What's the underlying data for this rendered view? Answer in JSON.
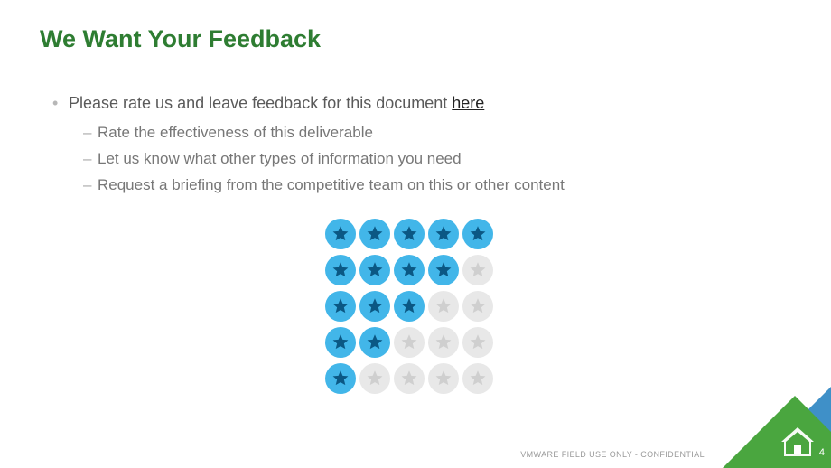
{
  "title": "We Want Your Feedback",
  "bullet": {
    "text_prefix": "Please rate us and leave feedback for this document ",
    "link_text": "here"
  },
  "sub_items": [
    "Rate the effectiveness of this deliverable",
    "Let us know what other types of information you need",
    "Request a briefing from the competitive team on this or other content"
  ],
  "ratings": [
    5,
    4,
    3,
    2,
    1
  ],
  "footer": "VMWARE FIELD USE ONLY - CONFIDENTIAL",
  "page_number": "4",
  "colors": {
    "title_green": "#2e7d32",
    "star_active_bg": "#42b6e9",
    "star_active_fill": "#0b5884",
    "star_inactive_bg": "#e8e8e8",
    "star_inactive_fill": "#cfcfcf",
    "corner_green": "#4aa63f",
    "corner_blue": "#3f90c8"
  }
}
